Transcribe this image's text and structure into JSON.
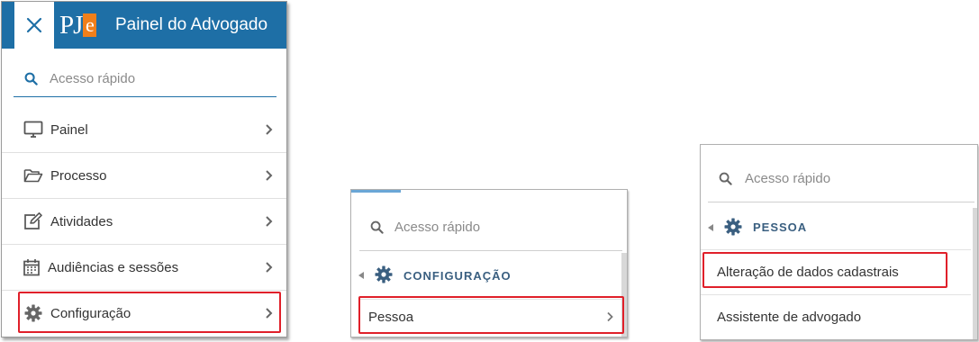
{
  "panel1": {
    "title": "Painel do Advogado",
    "logo_text": "PJ",
    "logo_e": "e",
    "search_placeholder": "Acesso rápido",
    "menu": [
      {
        "label": "Painel",
        "icon": "monitor-icon"
      },
      {
        "label": "Processo",
        "icon": "folder-open-icon"
      },
      {
        "label": "Atividades",
        "icon": "edit-icon"
      },
      {
        "label": "Audiências e sessões",
        "icon": "calendar-icon"
      },
      {
        "label": "Configuração",
        "icon": "gear-icon"
      }
    ]
  },
  "panel2": {
    "search_placeholder": "Acesso rápido",
    "section": "CONFIGURAÇÃO",
    "items": [
      {
        "label": "Pessoa"
      }
    ]
  },
  "panel3": {
    "search_placeholder": "Acesso rápido",
    "section": "PESSOA",
    "items": [
      {
        "label": "Alteração de dados cadastrais"
      },
      {
        "label": "Assistente de advogado"
      }
    ]
  },
  "colors": {
    "header": "#1e6fa6",
    "logo_orange": "#f07f1a",
    "highlight": "#e0202a",
    "section_text": "#3a5f80"
  }
}
